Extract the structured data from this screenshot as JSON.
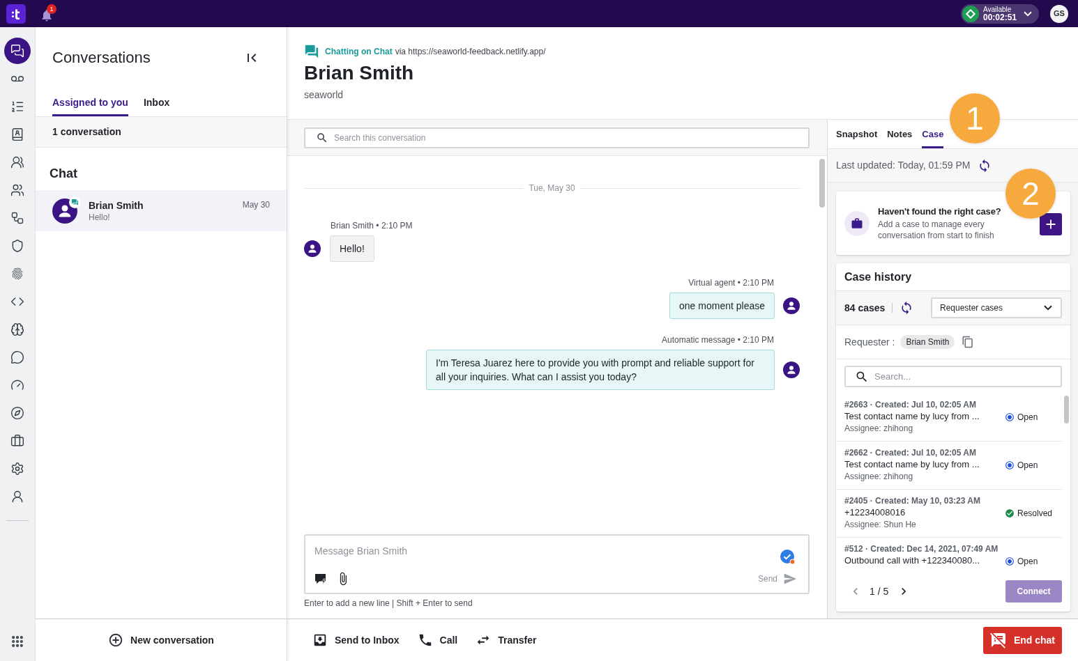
{
  "top_bar": {
    "notifications": {
      "count": "1"
    },
    "status": {
      "label": "Available",
      "timer": "00:02:51"
    },
    "user": {
      "initials": "GS"
    }
  },
  "nav_rail": {
    "items": [
      {
        "selected": true
      },
      {
        "selected": false
      },
      {
        "selected": false
      },
      {
        "selected": false
      },
      {
        "selected": false
      },
      {
        "selected": false
      },
      {
        "selected": false
      },
      {
        "selected": false
      },
      {
        "selected": false
      },
      {
        "selected": false
      },
      {
        "selected": false
      },
      {
        "selected": false
      },
      {
        "selected": false
      },
      {
        "selected": false
      },
      {
        "selected": false
      },
      {
        "selected": false
      },
      {
        "selected": false
      }
    ]
  },
  "conversations": {
    "title": "Conversations",
    "tabs": [
      {
        "label": "Assigned to you",
        "selected": true
      },
      {
        "label": "Inbox",
        "selected": false
      }
    ],
    "count": "1 conversation",
    "section": "Chat",
    "items": [
      {
        "name": "Brian Smith",
        "preview": "Hello!",
        "date": "May 30",
        "selected": true
      }
    ],
    "new_button": "New conversation"
  },
  "chat": {
    "channel": "Chatting on Chat",
    "source": "via https://seaworld-feedback.netlify.app/",
    "contact": "Brian Smith",
    "company": "seaworld",
    "search_placeholder": "Search this conversation",
    "date_divider": "Tue, May 30",
    "messages": [
      {
        "kind": "incoming",
        "meta": "Brian Smith • 2:10 PM",
        "text": "Hello!"
      },
      {
        "kind": "outgoing",
        "meta": "Virtual agent • 2:10 PM",
        "text": "one moment please"
      },
      {
        "kind": "outgoing",
        "meta": "Automatic message • 2:10 PM",
        "text": "I'm Teresa Juarez here to provide you with prompt and reliable support for all your inquiries. What can I assist you today?"
      }
    ],
    "composer": {
      "placeholder": "Message Brian Smith",
      "send": {
        "label": "Send",
        "disabled": true
      },
      "hint": "Enter to add a new line | Shift + Enter to send"
    }
  },
  "actions": [
    {
      "label": "Send to Inbox"
    },
    {
      "label": "Call"
    },
    {
      "label": "Transfer"
    }
  ],
  "end_chat": "End chat",
  "details": {
    "tabs": [
      {
        "label": "Snapshot",
        "selected": false
      },
      {
        "label": "Notes",
        "selected": false
      },
      {
        "label": "Case",
        "selected": true
      }
    ],
    "marker": "1",
    "last_updated": "Last updated: Today, 01:59 PM",
    "new_case": {
      "title": "Haven't found the right case?",
      "description": "Add a case to manage every conversation from start to finish",
      "marker": "2"
    },
    "case_history": {
      "title": "Case history",
      "count": "84 cases",
      "filter": "Requester cases",
      "requester_label": "Requester :",
      "requester": "Brian Smith",
      "search_placeholder": "Search...",
      "cases": [
        {
          "header": "#2663 · Created: Jul 10, 02:05 AM",
          "title": "Test contact name by lucy from ...",
          "assignee": "Assignee: zhihong",
          "status": "Open",
          "kind": "open"
        },
        {
          "header": "#2662 · Created: Jul 10, 02:05 AM",
          "title": "Test contact name by lucy from ...",
          "assignee": "Assignee: zhihong",
          "status": "Open",
          "kind": "open"
        },
        {
          "header": "#2405 · Created: May 10, 03:23 AM",
          "title": "+12234008016",
          "assignee": "Assignee: Shun He",
          "status": "Resolved",
          "kind": "resolved"
        },
        {
          "header": "#512 · Created: Dec 14, 2021, 07:49 AM",
          "title": "Outbound call with +122340080...",
          "status": "Open",
          "kind": "open"
        }
      ],
      "page": "1 / 5",
      "connect": {
        "label": "Connect",
        "disabled": true
      }
    }
  }
}
